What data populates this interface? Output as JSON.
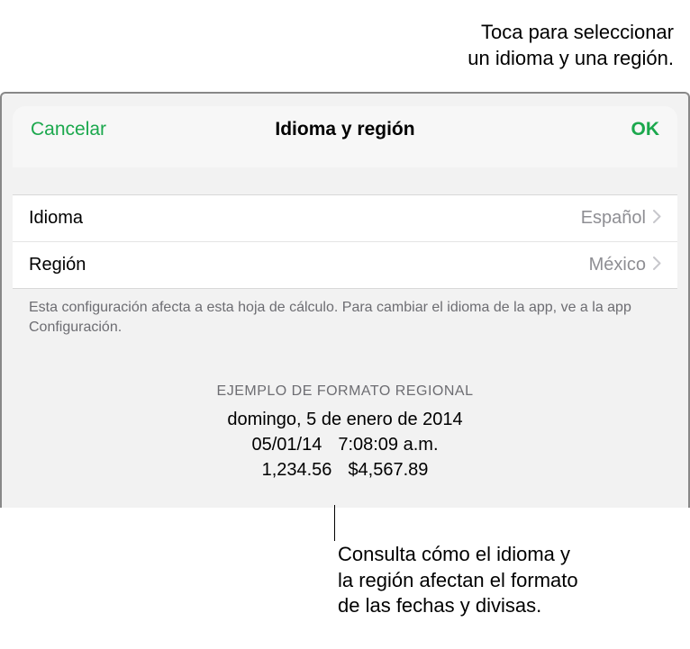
{
  "annotation_top": {
    "line1": "Toca para seleccionar",
    "line2": "un idioma y una región."
  },
  "modal": {
    "cancel": "Cancelar",
    "title": "Idioma y región",
    "ok": "OK",
    "rows": {
      "language": {
        "label": "Idioma",
        "value": "Español"
      },
      "region": {
        "label": "Región",
        "value": "México"
      }
    },
    "footer_note": "Esta configuración afecta a esta hoja de cálculo. Para cambiar el idioma de la app, ve a la app Configuración."
  },
  "example": {
    "header": "EJEMPLO DE FORMATO REGIONAL",
    "date_long": "domingo, 5 de enero de 2014",
    "date_short": "05/01/14",
    "time": "7:08:09 a.m.",
    "number": "1,234.56",
    "currency": "$4,567.89"
  },
  "annotation_bottom": {
    "line1": "Consulta cómo el idioma y",
    "line2": "la región afectan el formato",
    "line3": "de las fechas y divisas."
  }
}
